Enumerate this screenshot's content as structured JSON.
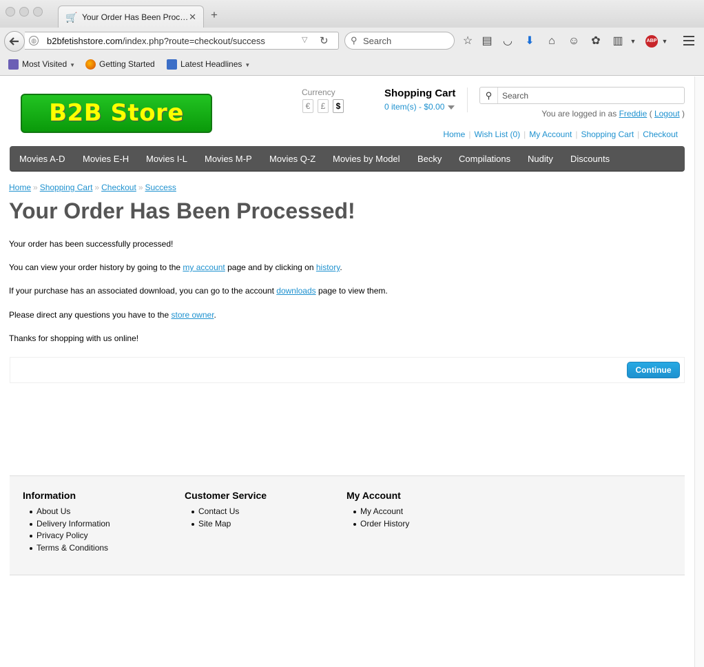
{
  "browser": {
    "tab_title": "Your Order Has Been Proc…",
    "tab_close": "✕",
    "new_tab": "+",
    "url_host": "b2bfetishstore.com",
    "url_path": "/index.php?route=checkout/success",
    "search_placeholder": "Search",
    "bookmarks": [
      {
        "label": "Most Visited",
        "caret": "▼"
      },
      {
        "label": "Getting Started"
      },
      {
        "label": "Latest Headlines",
        "caret": "▼"
      }
    ],
    "abp_label": "ABP"
  },
  "header": {
    "logo_text": "B2B Store",
    "currency_label": "Currency",
    "currencies": [
      "€",
      "£",
      "$"
    ],
    "cart_title": "Shopping Cart",
    "cart_summary": "0 item(s) - $0.00",
    "search_placeholder": "Search",
    "logged_prefix": "You are logged in as",
    "username": "Freddie",
    "logout_open": "(",
    "logout_label": "Logout",
    "logout_close": ")",
    "links": [
      "Home",
      "Wish List (0)",
      "My Account",
      "Shopping Cart",
      "Checkout"
    ]
  },
  "menu": {
    "items": [
      "Movies A-D",
      "Movies E-H",
      "Movies I-L",
      "Movies M-P",
      "Movies Q-Z",
      "Movies by Model",
      "Becky",
      "Compilations",
      "Nudity",
      "Discounts"
    ]
  },
  "breadcrumb": [
    "Home",
    "Shopping Cart",
    "Checkout",
    "Success"
  ],
  "content": {
    "heading": "Your Order Has Been Processed!",
    "p1": "Your order has been successfully processed!",
    "p2_a": "You can view your order history by going to the",
    "p2_link1": "my account",
    "p2_b": "page and by clicking on",
    "p2_link2": "history",
    "p2_c": ".",
    "p3_a": "If your purchase has an associated download, you can go to the account",
    "p3_link": "downloads",
    "p3_b": "page to view them.",
    "p4_a": "Please direct any questions you have to the",
    "p4_link": "store owner",
    "p4_b": ".",
    "p5": "Thanks for shopping with us online!",
    "continue_label": "Continue"
  },
  "footer": {
    "information": {
      "title": "Information",
      "items": [
        "About Us",
        "Delivery Information",
        "Privacy Policy",
        "Terms & Conditions"
      ]
    },
    "customer_service": {
      "title": "Customer Service",
      "items": [
        "Contact Us",
        "Site Map"
      ]
    },
    "my_account": {
      "title": "My Account",
      "items": [
        "My Account",
        "Order History"
      ]
    }
  },
  "colors": {
    "link": "#1e91cf",
    "menu_bg": "#555555",
    "logo_bg": "#1aaf1a",
    "logo_text": "#ffff00",
    "button": "#1e91cf"
  }
}
